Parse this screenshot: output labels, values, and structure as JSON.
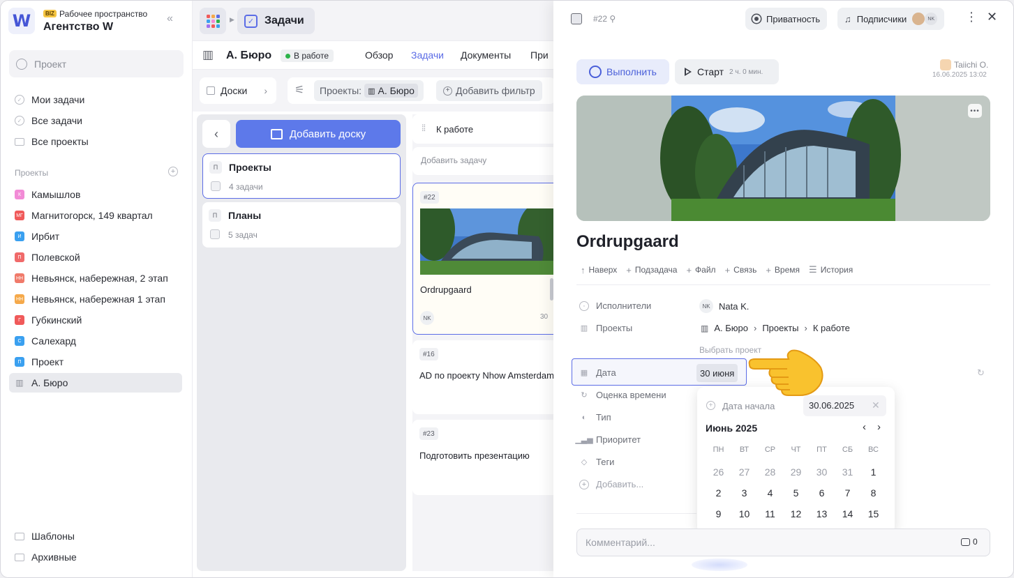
{
  "workspace": {
    "logo_letter": "W",
    "biz_badge": "BIZ",
    "subtitle": "Рабочее пространство",
    "name": "Агентство W"
  },
  "sidebar": {
    "search_placeholder": "Проект",
    "nav": [
      {
        "label": "Мои задачи"
      },
      {
        "label": "Все задачи"
      },
      {
        "label": "Все проекты"
      }
    ],
    "projects_label": "Проекты",
    "projects": [
      {
        "letter": "К",
        "label": "Камышлов",
        "color": "#f28bd6"
      },
      {
        "letter": "МГ",
        "label": "Магнитогорск, 149 квартал",
        "color": "#f05a5a"
      },
      {
        "letter": "И",
        "label": "Ирбит",
        "color": "#3aa0f0"
      },
      {
        "letter": "П",
        "label": "Полевской",
        "color": "#f06a6a"
      },
      {
        "letter": "НН",
        "label": "Невьянск, набережная, 2 этап",
        "color": "#f07a6a"
      },
      {
        "letter": "НН",
        "label": "Невьянск, набережная 1 этап",
        "color": "#f5a94a"
      },
      {
        "letter": "Г",
        "label": "Губкинский",
        "color": "#f05a5a"
      },
      {
        "letter": "С",
        "label": "Салехард",
        "color": "#3aa0f0"
      },
      {
        "letter": "П",
        "label": "Проект",
        "color": "#3aa0f0"
      },
      {
        "letter": "",
        "label": "А. Бюро",
        "color": "#8a8d96"
      }
    ],
    "bottom": [
      {
        "label": "Шаблоны"
      },
      {
        "label": "Архивные"
      }
    ]
  },
  "topbar": {
    "section": "Задачи"
  },
  "project": {
    "title": "А. Бюро",
    "status": "В работе",
    "tabs": [
      "Обзор",
      "Задачи",
      "Документы",
      "При"
    ]
  },
  "filters": {
    "boards": "Доски",
    "projects_label": "Проекты:",
    "projects_value": "А. Бюро",
    "add_filter": "Добавить фильтр"
  },
  "boards": {
    "add_label": "Добавить доску",
    "items": [
      {
        "letter": "П",
        "title": "Проекты",
        "count": "4 задачи"
      },
      {
        "letter": "П",
        "title": "Планы",
        "count": "5 задач"
      }
    ]
  },
  "column": {
    "title": "К работе",
    "add_task": "Добавить задачу",
    "tasks": [
      {
        "num": "#22",
        "title": "Ordrupgaard",
        "assignee": "NK",
        "date": "30"
      },
      {
        "num": "#16",
        "title": "AD по проекту Nhow Amsterdam"
      },
      {
        "num": "#23",
        "title": "Подготовить презентацию"
      }
    ]
  },
  "detail": {
    "num": "#22",
    "link_icon": "link-icon",
    "privacy": "Приватность",
    "subscribers": "Подписчики",
    "subscriber_initials": "NK",
    "complete": "Выполнить",
    "start": "Старт",
    "duration": "2 ч. 0 мин.",
    "author": "Taiichi O.",
    "created": "16.06.2025 13:02",
    "title": "Ordrupgaard",
    "actions": [
      {
        "icon": "arrow-up-icon",
        "label": "Наверх"
      },
      {
        "icon": "plus-icon",
        "label": "Подзадача"
      },
      {
        "icon": "plus-icon",
        "label": "Файл"
      },
      {
        "icon": "plus-icon",
        "label": "Связь"
      },
      {
        "icon": "plus-icon",
        "label": "Время"
      },
      {
        "icon": "list-icon",
        "label": "История"
      }
    ],
    "props": {
      "assignees_label": "Исполнители",
      "assignee_initials": "NK",
      "assignee_name": "Nata K.",
      "projects_label": "Проекты",
      "path": [
        "А. Бюро",
        "Проекты",
        "К работе"
      ],
      "choose_project": "Выбрать проект",
      "date_label": "Дата",
      "date_value": "30 июня",
      "estimate_label": "Оценка времени",
      "type_label": "Тип",
      "priority_label": "Приоритет",
      "tags_label": "Теги",
      "add_label": "Добавить..."
    },
    "comment_placeholder": "Комментарий...",
    "comment_count": "0"
  },
  "calendar": {
    "start_label": "Дата начала",
    "start_value": "30.06.2025",
    "month": "Июнь 2025",
    "weekdays": [
      "ПН",
      "ВТ",
      "СР",
      "ЧТ",
      "ПТ",
      "СБ",
      "ВС"
    ],
    "weeks": [
      [
        "26",
        "27",
        "28",
        "29",
        "30",
        "31",
        "1"
      ],
      [
        "2",
        "3",
        "4",
        "5",
        "6",
        "7",
        "8"
      ],
      [
        "9",
        "10",
        "11",
        "12",
        "13",
        "14",
        "15"
      ]
    ]
  }
}
